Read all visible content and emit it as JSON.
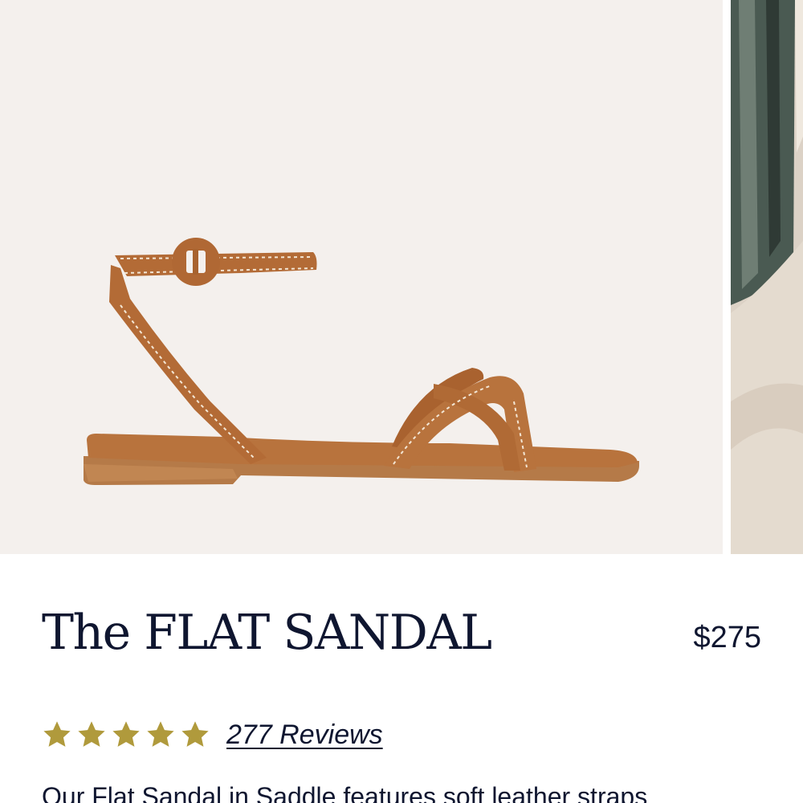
{
  "product": {
    "title": "The FLAT SANDAL",
    "price": "$275",
    "rating": {
      "stars": 5,
      "max_stars": 5,
      "star_color": "#b09a3c",
      "reviews_label": "277 Reviews"
    },
    "description": "Our Flat Sandal in Saddle features soft leather straps"
  },
  "gallery": {
    "slides": [
      {
        "content": "sandal-photo"
      },
      {
        "content": "beach-photo"
      }
    ]
  },
  "colors": {
    "text": "#0f1630",
    "leather": "#b6703a",
    "gallery_background": "#f4f0ed"
  }
}
